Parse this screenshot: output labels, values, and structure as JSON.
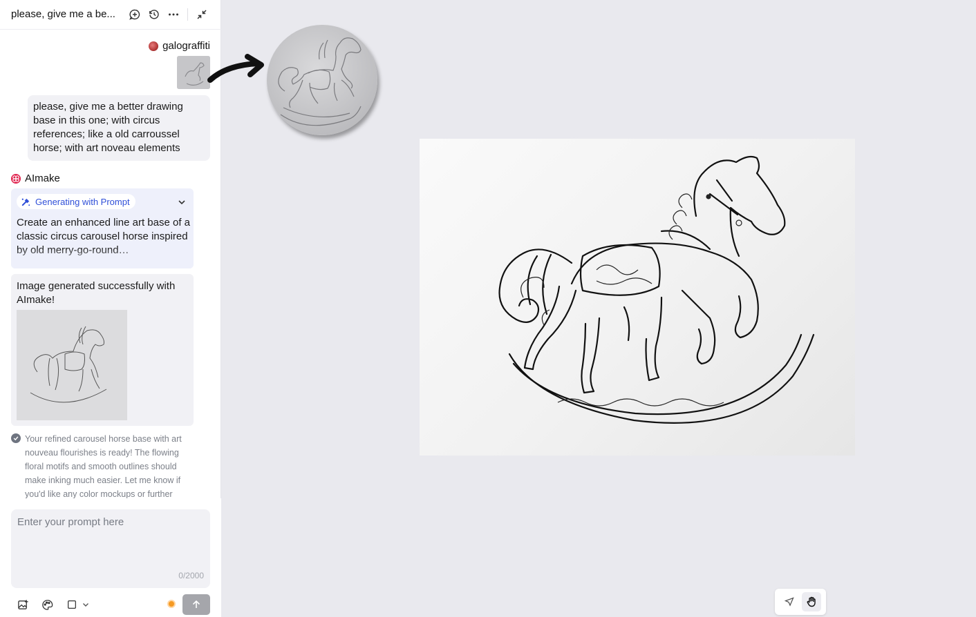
{
  "header": {
    "title": "please, give me a be...",
    "icons": [
      "new-chat-icon",
      "history-icon",
      "more-icon",
      "collapse-icon"
    ]
  },
  "chat": {
    "user": {
      "name": "galograffiti",
      "message": "please, give me a better drawing base in this one; with circus references; like a old carroussel horse; with art noveau elements"
    },
    "bot": {
      "name": "AImake",
      "status_label": "Generating with Prompt",
      "prompt_text": "Create an enhanced line art base of a classic circus carousel horse inspired by old merry-go-round…",
      "result_text": "Image generated successfully with AImake!",
      "note": "Your refined carousel horse base with art nouveau flourishes is ready! The flowing floral motifs and smooth outlines should make inking much easier. Let me know if you'd like any color mockups or further"
    }
  },
  "composer": {
    "placeholder": "Enter your prompt here",
    "counter": "0/2000"
  },
  "colors": {
    "accent_blue": "#2f4fd8",
    "brand_red": "#e0234e",
    "coin_orange": "#f59a23"
  }
}
